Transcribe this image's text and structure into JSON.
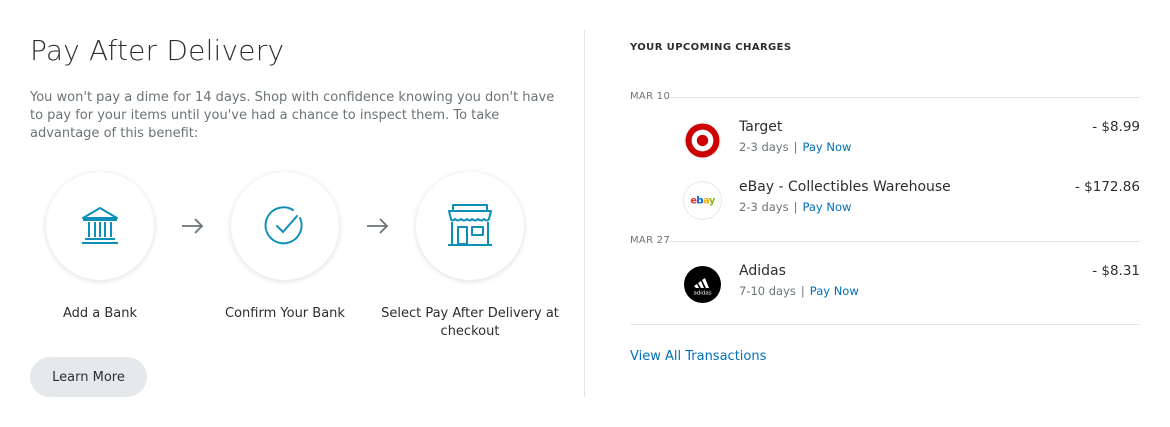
{
  "left": {
    "title": "Pay After Delivery",
    "description": "You won't pay a dime for 14 days. Shop with confidence knowing you don't have to pay for your items until you've had a chance to inspect them. To take advantage of this benefit:",
    "steps": [
      {
        "label": "Add a Bank",
        "icon": "bank-icon"
      },
      {
        "label": "Confirm Your Bank",
        "icon": "checkmark-circle-icon"
      },
      {
        "label": "Select Pay After Delivery at checkout",
        "icon": "storefront-icon"
      }
    ],
    "learn_more_label": "Learn More"
  },
  "right": {
    "heading": "YOUR UPCOMING CHARGES",
    "groups": [
      {
        "date": "MAR 10",
        "items": [
          {
            "merchant": "Target",
            "term": "2-3 days",
            "separator": "|",
            "action": "Pay Now",
            "amount": "- $8.99",
            "logo": "target-logo"
          },
          {
            "merchant": "eBay - Collectibles Warehouse",
            "term": "2-3 days",
            "separator": "|",
            "action": "Pay Now",
            "amount": "- $172.86",
            "logo": "ebay-logo",
            "logo_text": "ebay"
          }
        ]
      },
      {
        "date": "MAR 27",
        "items": [
          {
            "merchant": "Adidas",
            "term": "7-10 days",
            "separator": "|",
            "action": "Pay Now",
            "amount": "- $8.31",
            "logo": "adidas-logo",
            "logo_text": "adidas"
          }
        ]
      }
    ],
    "view_all_label": "View All Transactions"
  },
  "colors": {
    "accent": "#0070ba",
    "icon_blue": "#0d8fb8",
    "target_red": "#cc0000",
    "button_bg": "#e6e9ec"
  }
}
